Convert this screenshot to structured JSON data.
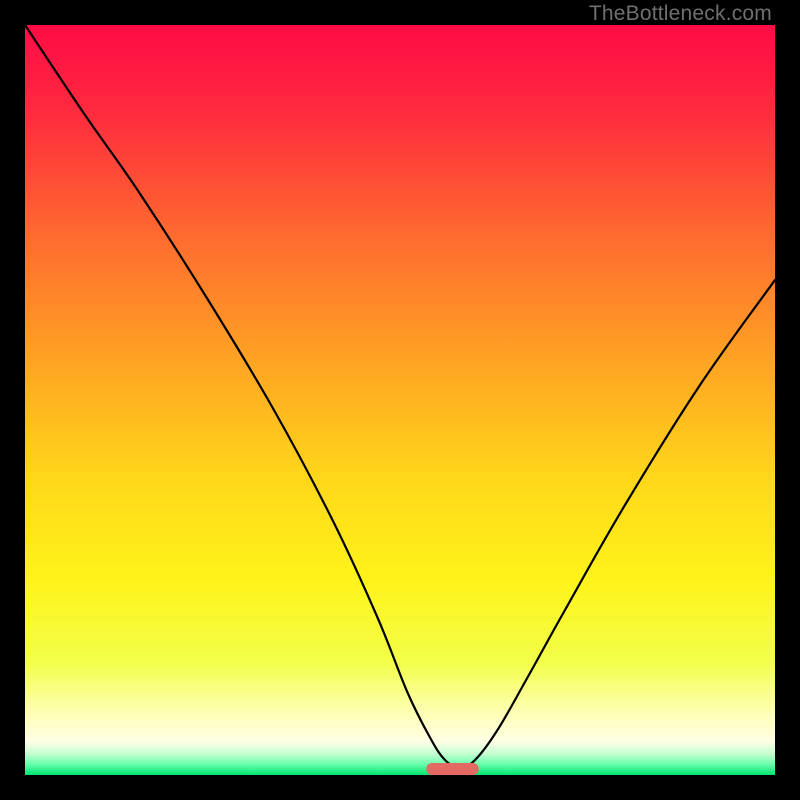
{
  "watermark": "TheBottleneck.com",
  "chart_data": {
    "type": "line",
    "title": "",
    "xlabel": "",
    "ylabel": "",
    "xlim": [
      0,
      100
    ],
    "ylim": [
      0,
      100
    ],
    "grid": false,
    "series": [
      {
        "name": "bottleneck-curve",
        "x": [
          0,
          8,
          15,
          24,
          33,
          41,
          47,
          51,
          54,
          56,
          58,
          60,
          63,
          67,
          72,
          80,
          90,
          100
        ],
        "values": [
          100,
          88,
          78,
          64,
          49,
          34,
          21,
          11,
          5,
          2,
          1,
          2,
          6,
          13,
          22,
          36,
          52,
          66
        ]
      }
    ],
    "optimal_marker": {
      "x_center": 57,
      "x_halfwidth": 3.5,
      "y": 0.8
    },
    "gradient_stops": [
      {
        "offset": 0,
        "color": "#ff0b46"
      },
      {
        "offset": 0.12,
        "color": "#ff2c3e"
      },
      {
        "offset": 0.28,
        "color": "#ff6a2f"
      },
      {
        "offset": 0.45,
        "color": "#ffa423"
      },
      {
        "offset": 0.6,
        "color": "#ffd61a"
      },
      {
        "offset": 0.74,
        "color": "#fff31a"
      },
      {
        "offset": 0.85,
        "color": "#f2ff4a"
      },
      {
        "offset": 0.92,
        "color": "#ffffb8"
      },
      {
        "offset": 0.955,
        "color": "#ffffe6"
      },
      {
        "offset": 0.972,
        "color": "#c4ffd0"
      },
      {
        "offset": 0.985,
        "color": "#6cffad"
      },
      {
        "offset": 1.0,
        "color": "#00e571"
      }
    ],
    "marker_color": "#e26a62",
    "curve_color": "#000000"
  }
}
